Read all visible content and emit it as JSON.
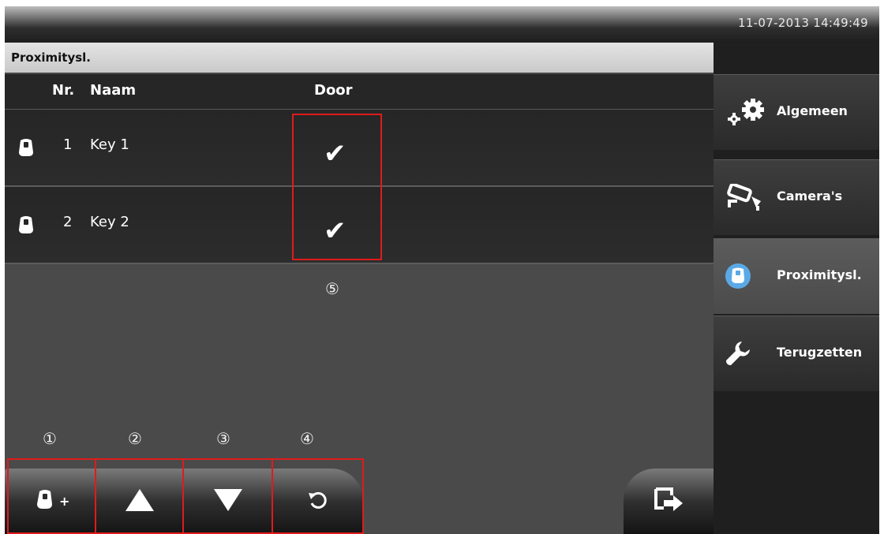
{
  "status_bar": {
    "datetime": "11-07-2013 14:49:49"
  },
  "page": {
    "title": "Proximitysl.",
    "columns": {
      "nr": "Nr.",
      "naam": "Naam",
      "door": "Door"
    },
    "rows": [
      {
        "nr": "1",
        "naam": "Key 1",
        "door": "✔",
        "icon": "proximity-key-icon"
      },
      {
        "nr": "2",
        "naam": "Key 2",
        "door": "✔",
        "icon": "proximity-key-icon"
      }
    ]
  },
  "annotations": {
    "n1": "①",
    "n2": "②",
    "n3": "③",
    "n4": "④",
    "n5": "⑤"
  },
  "toolbar": {
    "add_key": {
      "icon": "proximity-key-add-icon",
      "plus": "+"
    },
    "up": {
      "icon": "arrow-up-icon"
    },
    "down": {
      "icon": "arrow-down-icon"
    },
    "reset": {
      "icon": "refresh-icon"
    },
    "exit": {
      "icon": "exit-icon"
    }
  },
  "sidebar": {
    "items": [
      {
        "label": "Algemeen",
        "icon": "gears-icon",
        "active": false
      },
      {
        "label": "Camera's",
        "icon": "camera-icon",
        "active": false
      },
      {
        "label": "Proximitysl.",
        "icon": "proximity-key-icon",
        "active": true
      },
      {
        "label": "Terugzetten",
        "icon": "wrench-icon",
        "active": false
      }
    ]
  },
  "colors": {
    "annotation_red": "#e01b1b",
    "active_icon_blue": "#5aa9e6"
  }
}
